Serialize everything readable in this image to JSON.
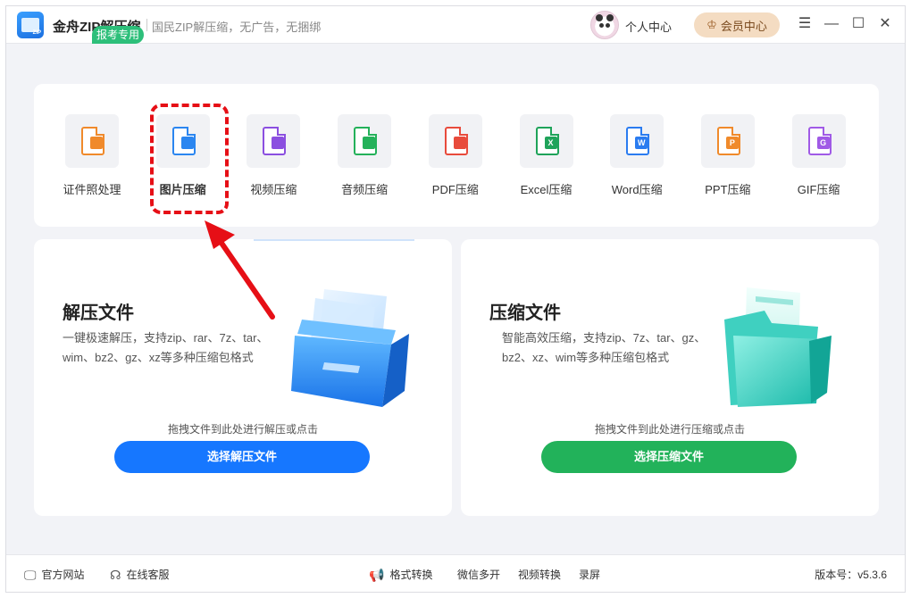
{
  "titlebar": {
    "app_name": "金舟ZIP解压缩",
    "slogan": "国民ZIP解压缩，无广告，无捆绑",
    "logo_text": "ZIP",
    "personal_center": "个人中心",
    "vip_center": "会员中心",
    "minimize_glyph": "—",
    "maximize_glyph": "☐",
    "close_glyph": "✕",
    "menu_glyph": "☰"
  },
  "tools": {
    "exam_tag": "报考专用",
    "items": [
      {
        "label": "证件照处理",
        "icon": "id-photo-icon",
        "color": "#f08a2b",
        "badge": ""
      },
      {
        "label": "图片压缩",
        "icon": "image-icon",
        "color": "#2b86f0",
        "badge": ""
      },
      {
        "label": "视频压缩",
        "icon": "video-icon",
        "color": "#8b4fe0",
        "badge": ""
      },
      {
        "label": "音频压缩",
        "icon": "audio-icon",
        "color": "#24b15a",
        "badge": ""
      },
      {
        "label": "PDF压缩",
        "icon": "pdf-icon",
        "color": "#e84b3c",
        "badge": ""
      },
      {
        "label": "Excel压缩",
        "icon": "excel-icon",
        "color": "#1fa35a",
        "badge": "X"
      },
      {
        "label": "Word压缩",
        "icon": "word-icon",
        "color": "#2b7cf0",
        "badge": "W"
      },
      {
        "label": "PPT压缩",
        "icon": "ppt-icon",
        "color": "#f08a2b",
        "badge": "P"
      },
      {
        "label": "GIF压缩",
        "icon": "gif-icon",
        "color": "#a05ae6",
        "badge": "G"
      }
    ]
  },
  "extract": {
    "title": "解压文件",
    "description": "一键极速解压，支持zip、rar、7z、tar、wim、bz2、gz、xz等多种压缩包格式",
    "hint": "拖拽文件到此处进行解压或点击",
    "button": "选择解压文件",
    "button_color": "#1677ff"
  },
  "compress": {
    "title": "压缩文件",
    "description": "智能高效压缩，支持zip、7z、tar、gz、bz2、xz、wim等多种压缩包格式",
    "hint": "拖拽文件到此处进行压缩或点击",
    "button": "选择压缩文件",
    "button_color": "#22b25a"
  },
  "statusbar": {
    "website": "官方网站",
    "support": "在线客服",
    "format_convert": "格式转换",
    "wechat_multi": "微信多开",
    "video_convert": "视频转换",
    "record": "录屏",
    "version": "版本号：v5.3.6"
  }
}
